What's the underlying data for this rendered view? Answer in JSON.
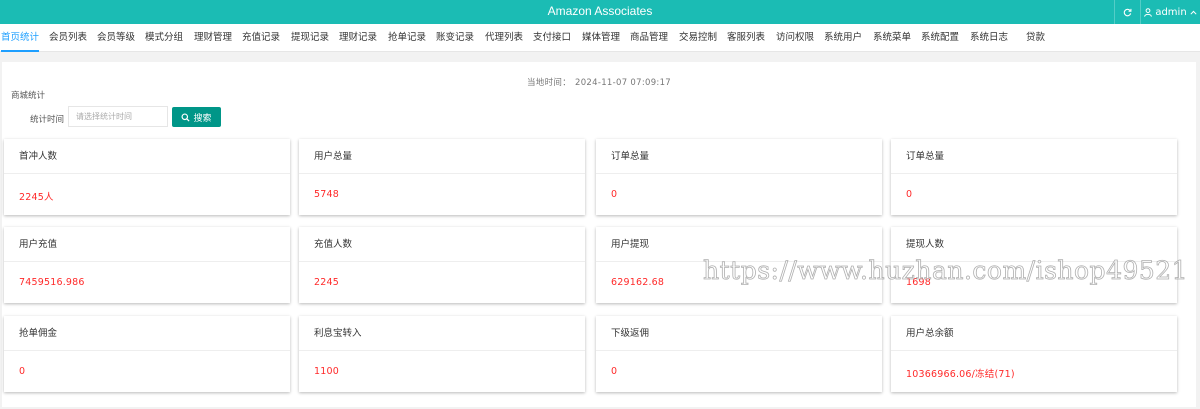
{
  "header": {
    "title": "Amazon Associates",
    "user": "admin"
  },
  "nav": [
    "首页统计",
    "会员列表",
    "会员等级",
    "模式分组",
    "理财管理",
    "充值记录",
    "提现记录",
    "理财记录",
    "抢单记录",
    "账变记录",
    "代理列表",
    "支付接口",
    "媒体管理",
    "商品管理",
    "交易控制",
    "客服列表",
    "访问权限",
    "系统用户",
    "系统菜单",
    "系统配置",
    "系统日志",
    "贷款"
  ],
  "main": {
    "time_label": "当地时间：",
    "time_value": "2024-11-07 07:09:17",
    "section_title": "商城统计",
    "filter_label": "统计时间",
    "filter_placeholder": "请选择统计时间",
    "search_label": "搜索"
  },
  "cards": [
    {
      "label": "首冲人数",
      "value": "2245人"
    },
    {
      "label": "用户总量",
      "value": "5748"
    },
    {
      "label": "订单总量",
      "value": "0"
    },
    {
      "label": "订单总量",
      "value": "0"
    },
    {
      "label": "用户充值",
      "value": "7459516.986"
    },
    {
      "label": "充值人数",
      "value": "2245"
    },
    {
      "label": "用户提现",
      "value": "629162.68"
    },
    {
      "label": "提现人数",
      "value": "1698"
    },
    {
      "label": "抢单佣金",
      "value": "0"
    },
    {
      "label": "利息宝转入",
      "value": "1100"
    },
    {
      "label": "下级返佣",
      "value": "0"
    },
    {
      "label": "用户总余额",
      "value": "10366966.06/冻结(71)"
    }
  ],
  "watermark": "https://www.huzhan.com/ishop49521",
  "colors": {
    "topbar": "#1bbcb4",
    "active_tab": "#1e9fff",
    "value_red": "#ff2a2a",
    "button_green": "#009688"
  }
}
